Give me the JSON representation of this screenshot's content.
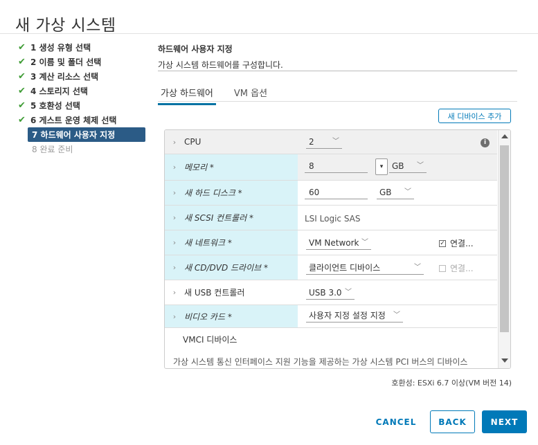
{
  "dialog": {
    "title": "새 가상 시스템"
  },
  "steps": [
    {
      "label": "1 생성 유형 선택",
      "state": "done"
    },
    {
      "label": "2 이름 및 폴더 선택",
      "state": "done"
    },
    {
      "label": "3 계산 리소스 선택",
      "state": "done"
    },
    {
      "label": "4 스토리지 선택",
      "state": "done"
    },
    {
      "label": "5 호환성 선택",
      "state": "done"
    },
    {
      "label": "6 게스트 운영 체제 선택",
      "state": "done"
    },
    {
      "label": "7 하드웨어 사용자 지정",
      "state": "active"
    },
    {
      "label": "8 완료 준비",
      "state": "pending"
    }
  ],
  "header": {
    "title": "하드웨어 사용자 지정",
    "subtitle": "가상 시스템 하드웨어를 구성합니다."
  },
  "tabs": [
    {
      "label": "가상 하드웨어",
      "active": true
    },
    {
      "label": "VM 옵션",
      "active": false
    }
  ],
  "add_device_label": "새 디바이스 추가",
  "hardware": {
    "cpu": {
      "label": "CPU",
      "value": "2"
    },
    "memory": {
      "label": "메모리 *",
      "value": "8",
      "unit": "GB"
    },
    "disk": {
      "label": "새 하드 디스크 *",
      "value": "60",
      "unit": "GB"
    },
    "scsi": {
      "label": "새 SCSI 컨트롤러 *",
      "value": "LSI Logic SAS"
    },
    "network": {
      "label": "새 네트워크 *",
      "value": "VM Network",
      "connect_label": "연결...",
      "connected": true
    },
    "cdrom": {
      "label": "새 CD/DVD 드라이브 *",
      "value": "클라이언트 디바이스",
      "connect_label": "연결...",
      "connected": false
    },
    "usb": {
      "label": "새 USB 컨트롤러",
      "value": "USB 3.0"
    },
    "video": {
      "label": "비디오 카드 *",
      "value": "사용자 지정 설정 지정"
    },
    "vmci": {
      "label": "VMCI 디바이스",
      "description": "가상 시스템 통신 인터페이스 지원 기능을 제공하는 가상 시스템 PCI 버스의 디바이스"
    }
  },
  "compatibility": "호환성: ESXi 6.7 이상(VM 버전 14)",
  "buttons": {
    "cancel": "CANCEL",
    "back": "BACK",
    "next": "NEXT"
  },
  "colors": {
    "accent": "#0079b8",
    "active_step": "#2b5b86",
    "required_row": "#d9f3f8",
    "check": "#3f9c35"
  }
}
